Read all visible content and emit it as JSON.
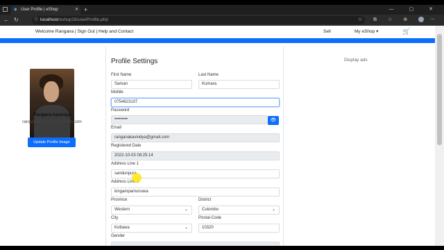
{
  "browser": {
    "tab_title": "User Profile | eShop",
    "url_host": "localhost",
    "url_path": "/eshop16/userProfile.php",
    "new_tab": "+",
    "window_controls": "— ▢ ✕"
  },
  "topnav": {
    "welcome": "Welcome Rangana | Sign Out | Help and Contact",
    "sell": "Sell",
    "my_eshop": "My eShop ▾"
  },
  "profile": {
    "name": "Rangana kavindya",
    "email": "ranganakavindya@gmail.com",
    "update_image_label": "Update Profile Image"
  },
  "form": {
    "title": "Profile Settings",
    "first_name_label": "First Name",
    "first_name": "Saman",
    "last_name_label": "Last Name",
    "last_name": "Kumara",
    "mobile_label": "Mobile",
    "mobile": "0754623107",
    "password_label": "Password",
    "password": "•••••••••",
    "email_label": "Email",
    "email": "ranganakavindya@gmail.com",
    "registered_label": "Registered Date",
    "registered": "2022-10-03 08:25:14",
    "address1_label": "Address Line 1",
    "address1": "sandunpura",
    "address2_label": "Address Line 2",
    "address2": "kingampamunuwa",
    "province_label": "Province",
    "province": "Western",
    "district_label": "District",
    "district": "Colombo",
    "city_label": "City",
    "city": "Kottawa",
    "postal_label": "Postal-Code",
    "postal": "10320",
    "gender_label": "Gender"
  },
  "ads": {
    "label": "Display ads"
  },
  "colors": {
    "primary": "#0d6efd",
    "readonly_bg": "#e9ecef"
  }
}
